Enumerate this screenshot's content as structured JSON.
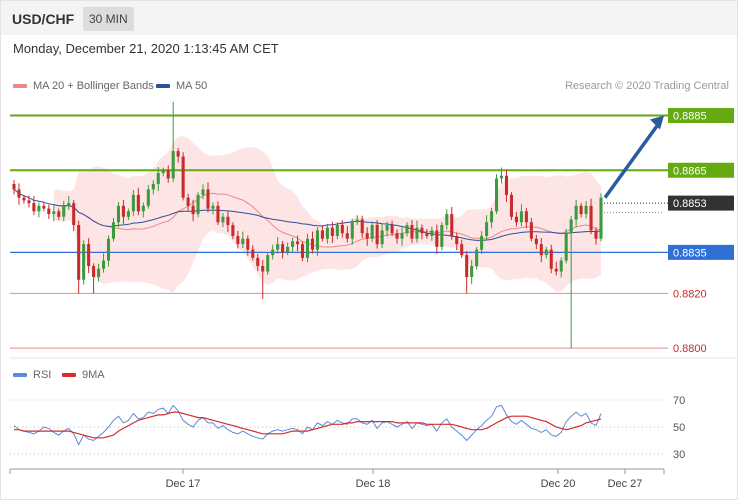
{
  "header": {
    "symbol": "USD/CHF",
    "timeframe": "30 MIN",
    "datetime": "Monday, December 21, 2020 1:13:45 AM CET"
  },
  "legend": {
    "ma20_label": "MA 20 + Bollinger Bands",
    "ma50_label": "MA 50",
    "credit": "Research © 2020 Trading Central"
  },
  "colors": {
    "bull": "#3d9a3d",
    "bear": "#c72b2b",
    "ma20": "#e88a8a",
    "ma50": "#2f4f9a",
    "band_fill": "#fde0e0",
    "resistance": "#66aa11",
    "support": "#2f6fd6",
    "minor": "#e88a8a",
    "current": "#333333",
    "rsi": "#5b8ad6",
    "rsi_ma": "#d62c2c",
    "arrow": "#2a5aa0"
  },
  "chart_data": [
    {
      "type": "candlestick",
      "ylim": [
        0.87975,
        0.88925
      ],
      "x_tick_labels": [
        "Dec 17",
        "Dec 18",
        "Dec 20",
        "Dec 27"
      ],
      "price_levels": [
        {
          "value": 0.8885,
          "label": "0.8885",
          "kind": "resistance"
        },
        {
          "value": 0.8865,
          "label": "0.8865",
          "kind": "resistance"
        },
        {
          "value": 0.8853,
          "label": "0.8853",
          "kind": "current"
        },
        {
          "value": 0.8835,
          "label": "0.8835",
          "kind": "support"
        },
        {
          "value": 0.882,
          "label": "0.8820",
          "kind": "minor"
        },
        {
          "value": 0.88,
          "label": "0.8800",
          "kind": "minor"
        }
      ],
      "forecast_target": 0.8885,
      "closes": [
        0.8858,
        0.8855,
        0.8854,
        0.8853,
        0.885,
        0.8852,
        0.8851,
        0.8849,
        0.885,
        0.8848,
        0.8852,
        0.8853,
        0.8845,
        0.8825,
        0.8838,
        0.883,
        0.8826,
        0.8829,
        0.8832,
        0.884,
        0.8846,
        0.8852,
        0.8848,
        0.885,
        0.8856,
        0.885,
        0.8852,
        0.8858,
        0.886,
        0.8864,
        0.8865,
        0.8862,
        0.8872,
        0.887,
        0.8855,
        0.8852,
        0.8849,
        0.8856,
        0.8858,
        0.8851,
        0.8852,
        0.8846,
        0.8848,
        0.8845,
        0.8841,
        0.8838,
        0.884,
        0.8836,
        0.8833,
        0.883,
        0.8828,
        0.8834,
        0.8836,
        0.8838,
        0.8835,
        0.8837,
        0.8839,
        0.8838,
        0.8833,
        0.884,
        0.8836,
        0.8843,
        0.884,
        0.8844,
        0.8841,
        0.8845,
        0.8842,
        0.884,
        0.8846,
        0.8847,
        0.8842,
        0.884,
        0.8845,
        0.8838,
        0.8843,
        0.8845,
        0.8842,
        0.884,
        0.8842,
        0.8845,
        0.884,
        0.8844,
        0.8842,
        0.8841,
        0.8843,
        0.8837,
        0.8845,
        0.8849,
        0.8841,
        0.8838,
        0.8834,
        0.8826,
        0.883,
        0.8836,
        0.8841,
        0.8846,
        0.885,
        0.8862,
        0.8863,
        0.8856,
        0.8848,
        0.8846,
        0.885,
        0.8846,
        0.884,
        0.8838,
        0.8834,
        0.8836,
        0.8829,
        0.8828,
        0.8832,
        0.8842,
        0.8847,
        0.8852,
        0.8849,
        0.8852,
        0.8843,
        0.884,
        0.8855
      ],
      "indices": {
        "lowest_low": 112
      }
    },
    {
      "type": "line",
      "title": "RSI",
      "yticks": [
        30,
        50,
        70
      ],
      "series": [
        {
          "name": "RSI",
          "values": [
            51,
            48,
            47,
            46,
            45,
            47,
            50,
            49,
            46,
            44,
            47,
            49,
            45,
            37,
            44,
            41,
            40,
            43,
            46,
            50,
            55,
            58,
            53,
            55,
            60,
            56,
            57,
            61,
            60,
            63,
            64,
            60,
            66,
            62,
            55,
            52,
            50,
            55,
            57,
            53,
            53,
            49,
            51,
            48,
            46,
            45,
            47,
            45,
            43,
            42,
            41,
            45,
            47,
            48,
            47,
            48,
            49,
            48,
            45,
            50,
            48,
            53,
            51,
            54,
            52,
            55,
            53,
            52,
            56,
            56,
            53,
            52,
            55,
            49,
            53,
            54,
            52,
            50,
            52,
            54,
            49,
            53,
            52,
            51,
            52,
            47,
            53,
            56,
            50,
            47,
            44,
            40,
            44,
            48,
            51,
            55,
            58,
            65,
            66,
            59,
            54,
            52,
            55,
            52,
            49,
            48,
            46,
            48,
            44,
            43,
            46,
            54,
            58,
            61,
            58,
            60,
            53,
            51,
            60
          ]
        },
        {
          "name": "9MA",
          "values": [
            48,
            48,
            47,
            47,
            47,
            47,
            47,
            47,
            47,
            47,
            47,
            47,
            46,
            45,
            44,
            43,
            42,
            42,
            42,
            43,
            44,
            47,
            49,
            51,
            53,
            55,
            56,
            57,
            58,
            59,
            59,
            60,
            61,
            61,
            60,
            59,
            58,
            57,
            57,
            56,
            55,
            54,
            53,
            52,
            51,
            50,
            49,
            48,
            47,
            46,
            45,
            45,
            45,
            45,
            45,
            46,
            47,
            47,
            47,
            47,
            48,
            49,
            50,
            51,
            52,
            52,
            52,
            53,
            53,
            54,
            54,
            54,
            54,
            54,
            54,
            54,
            54,
            53,
            53,
            53,
            53,
            53,
            53,
            52,
            52,
            52,
            52,
            52,
            52,
            51,
            50,
            49,
            48,
            48,
            48,
            49,
            51,
            53,
            55,
            57,
            58,
            58,
            58,
            58,
            57,
            56,
            55,
            54,
            52,
            50,
            49,
            48,
            49,
            50,
            51,
            53,
            54,
            55,
            56
          ]
        }
      ]
    }
  ]
}
